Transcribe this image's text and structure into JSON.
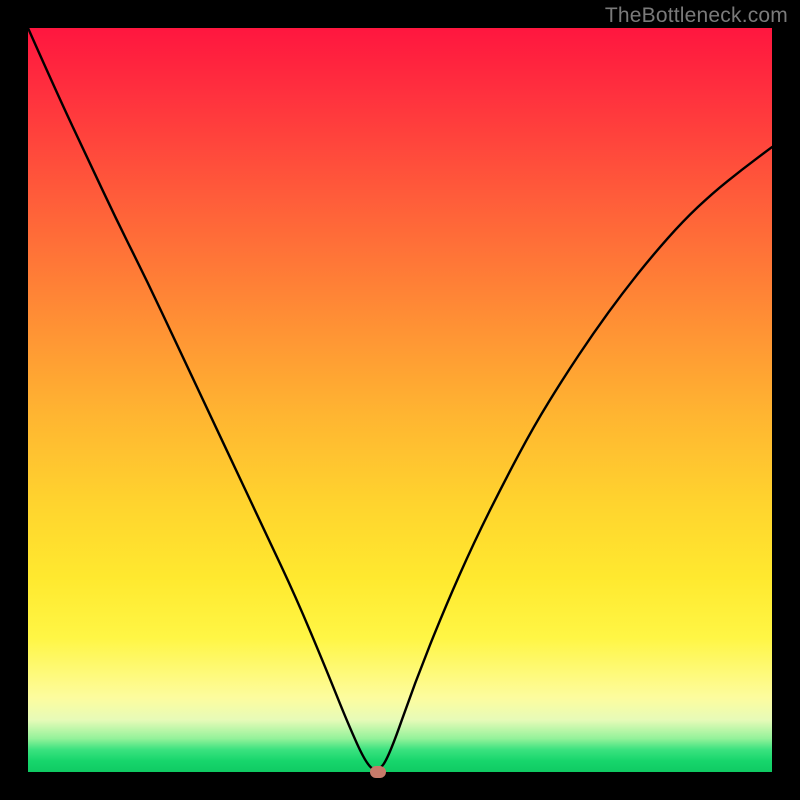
{
  "watermark": "TheBottleneck.com",
  "chart_data": {
    "type": "line",
    "title": "",
    "xlabel": "",
    "ylabel": "",
    "xlim": [
      0,
      100
    ],
    "ylim": [
      0,
      100
    ],
    "gradient_colors": {
      "top": "#ff163f",
      "mid_upper": "#ff8b35",
      "mid": "#ffe92f",
      "mid_lower": "#fdfc9e",
      "bottom": "#0fca63"
    },
    "series": [
      {
        "name": "bottleneck-curve",
        "x": [
          0,
          4,
          8,
          12,
          16,
          20,
          24,
          28,
          32,
          36,
          40,
          43,
          45.5,
          47,
          48.5,
          52,
          56,
          60,
          64,
          68,
          72,
          76,
          80,
          84,
          88,
          92,
          96,
          100
        ],
        "y": [
          100,
          91,
          82.5,
          74,
          66,
          57.5,
          49,
          40.5,
          32,
          23.5,
          14,
          6.5,
          1,
          0,
          2,
          12,
          22,
          31,
          39,
          46.5,
          53,
          59,
          64.5,
          69.5,
          74,
          77.8,
          81,
          84
        ]
      }
    ],
    "marker": {
      "name": "optimal-point",
      "x": 47,
      "y": 0,
      "color": "#c77a6a"
    }
  }
}
